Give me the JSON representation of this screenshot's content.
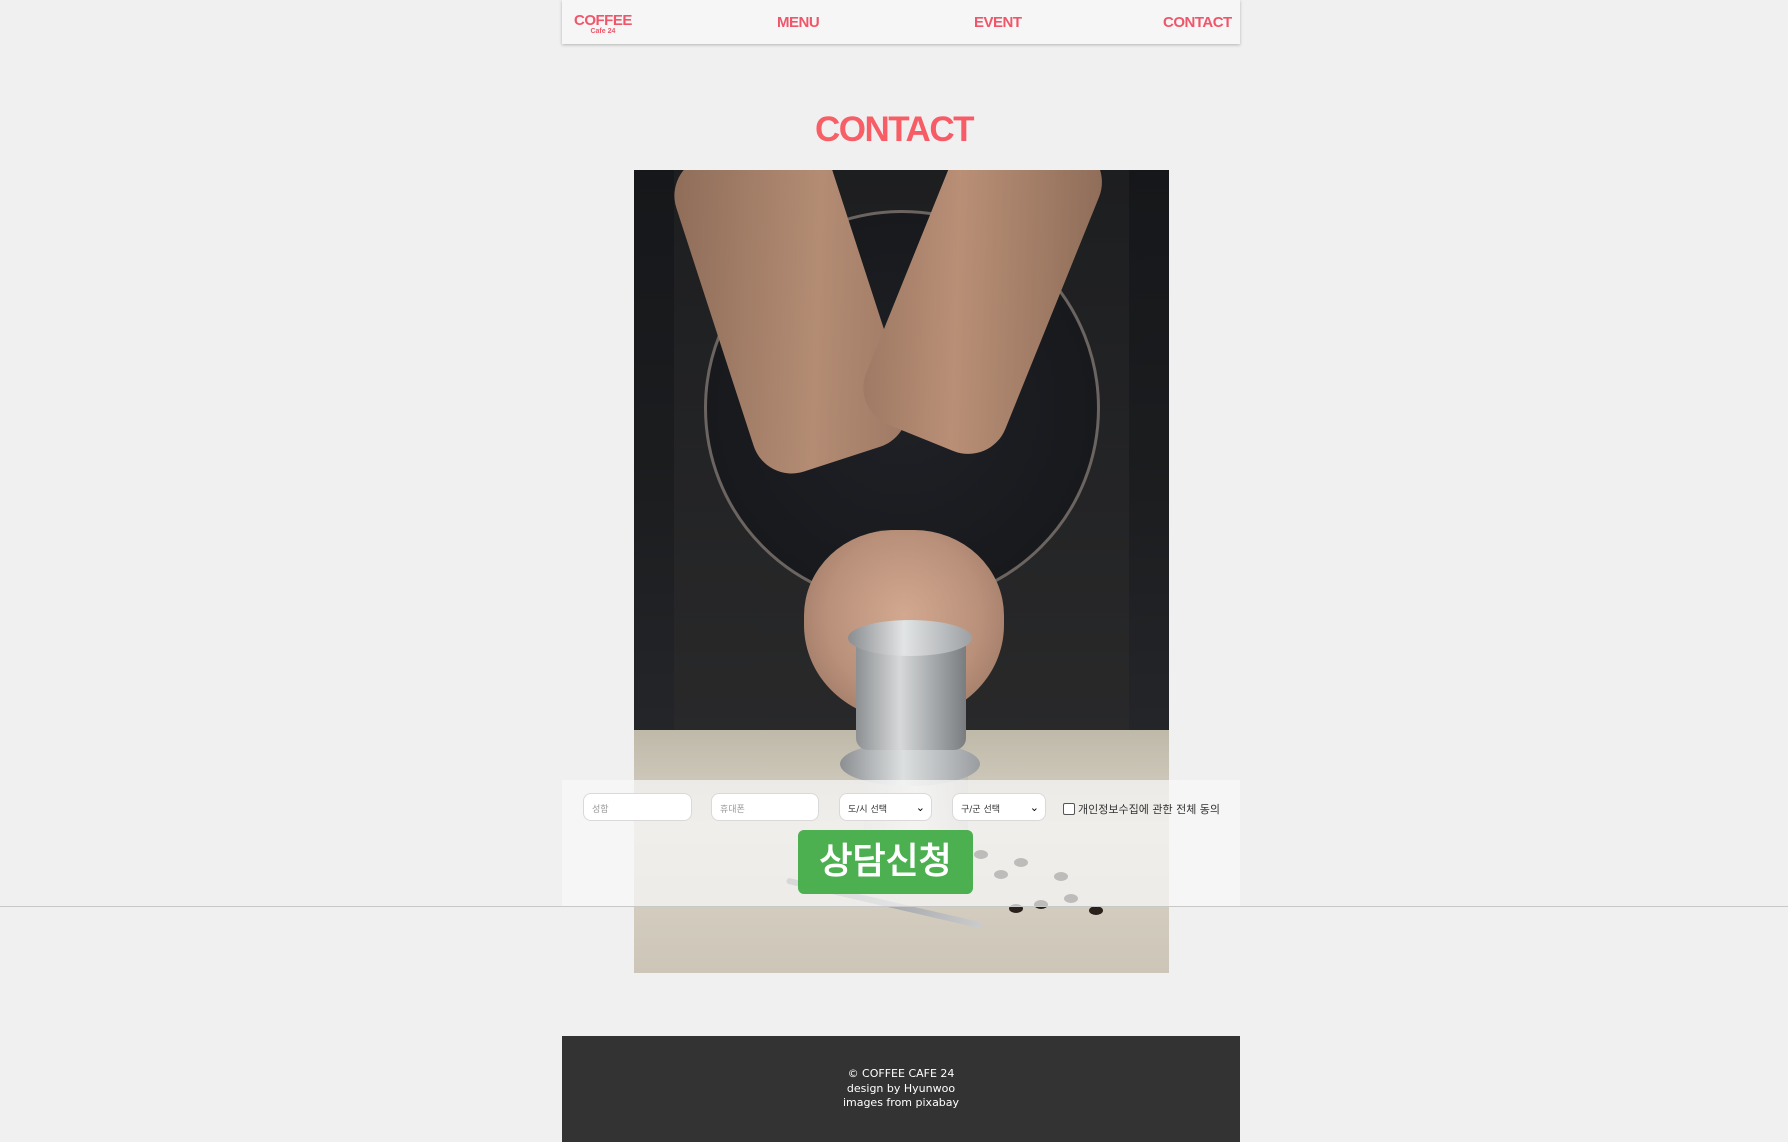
{
  "nav": {
    "logo": "COFFEE",
    "logo_sub": "Cafe 24",
    "links": [
      "MENU",
      "EVENT",
      "CONTACT"
    ]
  },
  "page": {
    "title": "CONTACT"
  },
  "form": {
    "name_placeholder": "성함",
    "phone_placeholder": "휴대폰",
    "city_select": "도/시 선택",
    "district_select": "구/군 선택",
    "agree_label": "개인정보수집에 관한 전체 동의",
    "submit_label": "상담신청",
    "submit_color": "#4caf50"
  },
  "footer": {
    "copyright": "© COFFEE CAFE 24",
    "design": "design by Hyunwoo",
    "images": "images from pixabay"
  },
  "colors": {
    "brand": "#f0566a",
    "footer_bg": "#333333",
    "page_bg": "#f0f0f0"
  }
}
